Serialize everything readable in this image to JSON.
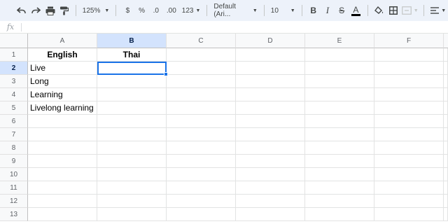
{
  "toolbar": {
    "zoom": "125%",
    "currency": "$",
    "percent": "%",
    "decrease_decimal": ".0",
    "increase_decimal": ".00",
    "more_formats": "123",
    "font": "Default (Ari...",
    "font_size": "10",
    "bold": "B",
    "italic": "I",
    "strikethrough": "S",
    "text_color": "A",
    "text_color_value": "#000000"
  },
  "formula_bar": {
    "fx": "fx",
    "value": ""
  },
  "sheet": {
    "columns": [
      "A",
      "B",
      "C",
      "D",
      "E",
      "F"
    ],
    "rows": [
      "1",
      "2",
      "3",
      "4",
      "5",
      "6",
      "7",
      "8",
      "9",
      "10",
      "11",
      "12",
      "13"
    ],
    "cells": {
      "A1": "English",
      "B1": "Thai",
      "A2": "Live",
      "A3": "Long",
      "A4": "Learning",
      "A5": "Livelong learning"
    },
    "selected_cell": "B2",
    "selection_color": "#1a73e8"
  }
}
